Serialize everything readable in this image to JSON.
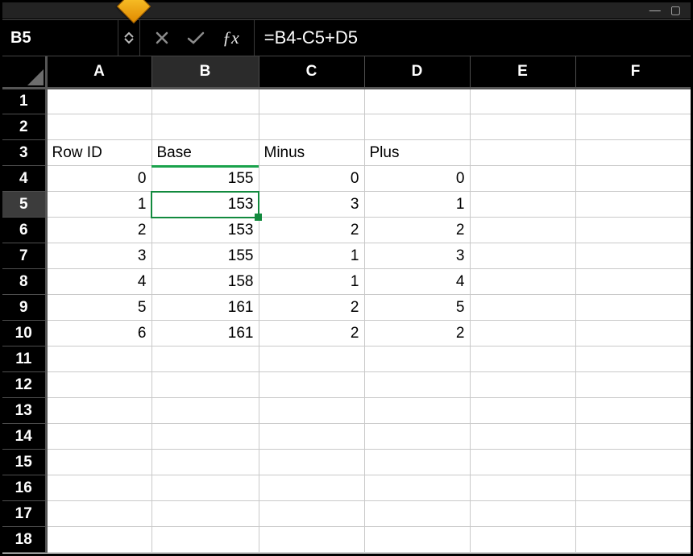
{
  "name_box": "B5",
  "formula": "=B4-C5+D5",
  "columns": [
    "A",
    "B",
    "C",
    "D",
    "E",
    "F"
  ],
  "selected_col_index": 1,
  "selected_row_index": 4,
  "row_headers": [
    "1",
    "2",
    "3",
    "4",
    "5",
    "6",
    "7",
    "8",
    "9",
    "10",
    "11",
    "12",
    "13",
    "14",
    "15",
    "16",
    "17",
    "18"
  ],
  "cells": {
    "r3": {
      "A": "Row ID",
      "B": "Base",
      "C": "Minus",
      "D": "Plus"
    },
    "r4": {
      "A": "0",
      "B": "155",
      "C": "0",
      "D": "0"
    },
    "r5": {
      "A": "1",
      "B": "153",
      "C": "3",
      "D": "1"
    },
    "r6": {
      "A": "2",
      "B": "153",
      "C": "2",
      "D": "2"
    },
    "r7": {
      "A": "3",
      "B": "155",
      "C": "1",
      "D": "3"
    },
    "r8": {
      "A": "4",
      "B": "158",
      "C": "1",
      "D": "4"
    },
    "r9": {
      "A": "5",
      "B": "161",
      "C": "2",
      "D": "5"
    },
    "r10": {
      "A": "6",
      "B": "161",
      "C": "2",
      "D": "2"
    }
  },
  "text_rows": [
    3
  ],
  "chart_data": {
    "type": "table",
    "columns": [
      "Row ID",
      "Base",
      "Minus",
      "Plus"
    ],
    "rows": [
      [
        0,
        155,
        0,
        0
      ],
      [
        1,
        153,
        3,
        1
      ],
      [
        2,
        153,
        2,
        2
      ],
      [
        3,
        155,
        1,
        3
      ],
      [
        4,
        158,
        1,
        4
      ],
      [
        5,
        161,
        2,
        5
      ],
      [
        6,
        161,
        2,
        2
      ]
    ]
  },
  "selection": {
    "cell": "B5",
    "col": "B",
    "row": 5
  }
}
